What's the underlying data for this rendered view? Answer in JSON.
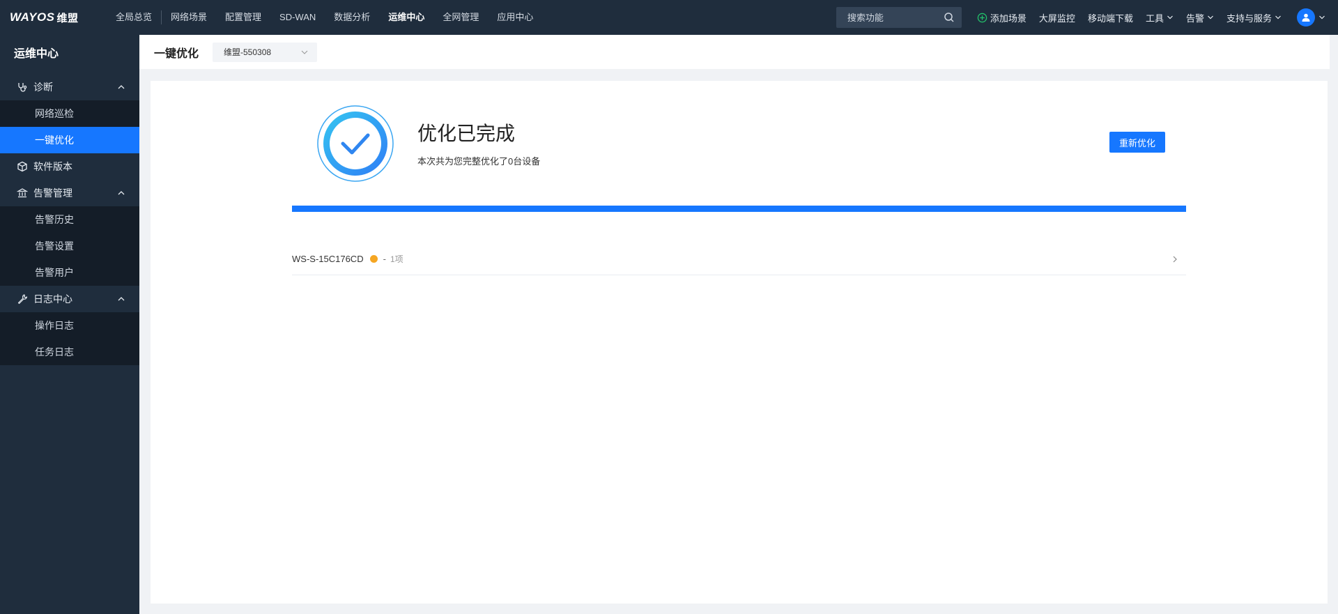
{
  "brand": {
    "logo_en": "WAYOS",
    "logo_cn": "维盟"
  },
  "topnav": {
    "items": [
      "全局总览",
      "网络场景",
      "配置管理",
      "SD-WAN",
      "数据分析",
      "运维中心",
      "全网管理",
      "应用中心"
    ],
    "active": "运维中心"
  },
  "topright": {
    "search_placeholder": "搜索功能",
    "add_scene": "添加场景",
    "big_screen": "大屏监控",
    "mobile_download": "移动端下载",
    "tools": "工具",
    "alarm": "告警",
    "support": "支持与服务"
  },
  "sidebar": {
    "title": "运维中心",
    "groups": [
      {
        "label": "诊断",
        "icon": "stethoscope-icon",
        "items": [
          "网络巡检",
          "一键优化"
        ]
      },
      {
        "label": "软件版本",
        "icon": "cube-icon",
        "items": []
      },
      {
        "label": "告警管理",
        "icon": "bank-icon",
        "items": [
          "告警历史",
          "告警设置",
          "告警用户"
        ]
      },
      {
        "label": "日志中心",
        "icon": "wrench-icon",
        "items": [
          "操作日志",
          "任务日志"
        ]
      }
    ],
    "active_item": "一键优化"
  },
  "header": {
    "title": "一键优化",
    "selected_site": "维盟-550308"
  },
  "result": {
    "title": "优化已完成",
    "subtitle": "本次共为您完整优化了0台设备",
    "button": "重新优化",
    "progress_percent": 100
  },
  "devices": [
    {
      "name": "WS-S-15C176CD",
      "status_color": "#f5a623",
      "separator": "-",
      "count": "1项"
    }
  ],
  "colors": {
    "accent": "#1677ff",
    "nav_bg": "#1f2d3d",
    "sub_bg": "#141d28",
    "warning": "#f5a623"
  }
}
